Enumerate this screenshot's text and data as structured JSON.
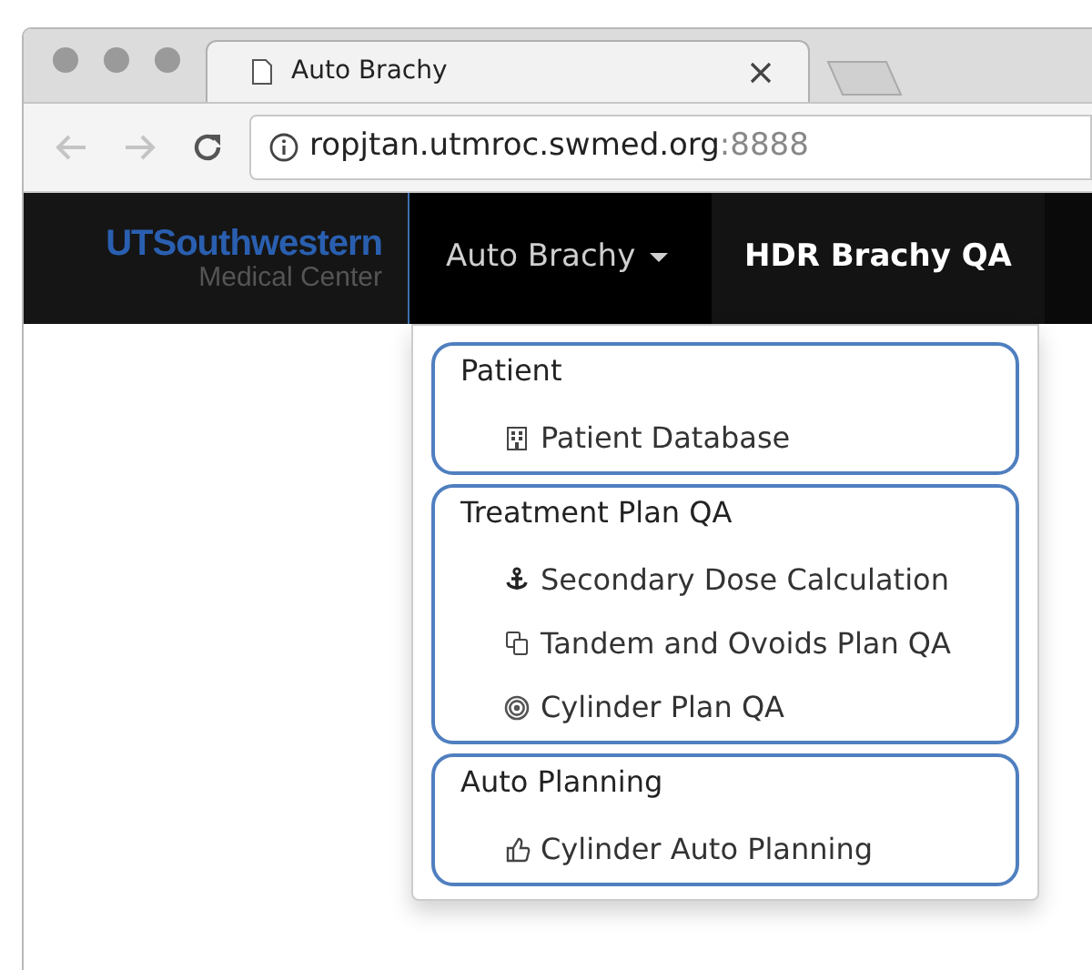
{
  "browser": {
    "tab_title": "Auto Brachy",
    "url_host": "ropjtan.utmroc.swmed.org",
    "url_port": ":8888"
  },
  "logo": {
    "line_1": "UTSouthwestern",
    "line_2": "Medical Center"
  },
  "nav_items": [
    {
      "label": "Auto Brachy",
      "expanded": true
    },
    {
      "label": "HDR Brachy QA",
      "expanded": false
    }
  ],
  "menu_groups": [
    {
      "header": "Patient",
      "items": [
        "Patient Database"
      ]
    },
    {
      "header": "Treatment Plan QA",
      "items": [
        "Secondary Dose Calculation",
        "Tandem and Ovoids Plan QA",
        "Cylinder Plan QA"
      ]
    },
    {
      "header": "Auto Planning",
      "items": [
        "Cylinder Auto Planning"
      ]
    }
  ]
}
